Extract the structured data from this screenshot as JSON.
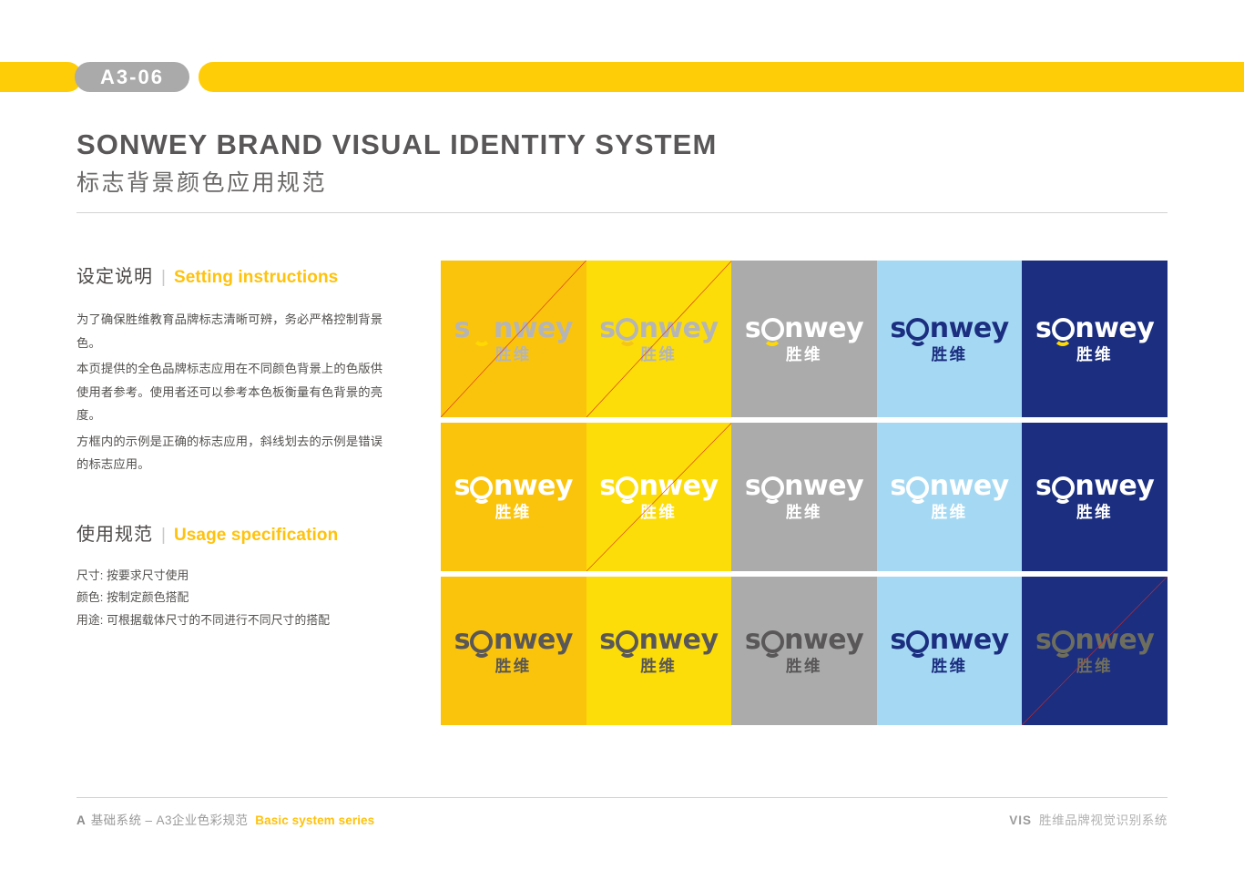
{
  "header": {
    "page_code": "A3-06",
    "bar_color": "#FFCD07",
    "pill_color": "#AAAAAA"
  },
  "title": {
    "en": "SONWEY BRAND VISUAL IDENTITY SYSTEM",
    "cn": "标志背景颜色应用规范"
  },
  "sections": [
    {
      "heading_cn": "设定说明",
      "heading_en": "Setting instructions",
      "separator": "|",
      "paragraphs": [
        "为了确保胜维教育品牌标志清晰可辨，务必严格控制背景色。",
        "本页提供的全色品牌标志应用在不同颜色背景上的色版供使用者参考。使用者还可以参考本色板衡量有色背景的亮度。",
        "方框内的示例是正确的标志应用，斜线划去的示例是错误的标志应用。"
      ]
    },
    {
      "heading_cn": "使用规范",
      "heading_en": "Usage specification",
      "separator": "|",
      "lines": [
        "尺寸: 按要求尺寸使用",
        "颜色: 按制定颜色搭配",
        "用途: 可根据载体尺寸的不同进行不同尺寸的搭配"
      ]
    }
  ],
  "logo": {
    "wordmark_before": "s",
    "wordmark_after": "nwey",
    "cn_name": "胜维",
    "o_icon": "smiley-o-icon"
  },
  "palette": {
    "golden_yellow": "#FBC40C",
    "bright_yellow": "#FCDD09",
    "gray": "#ABABAB",
    "light_blue": "#A5D9F3",
    "navy": "#1B2E80",
    "logo_white": "#FFFFFF",
    "logo_gray": "#B5B5B6",
    "logo_dark_gray": "#595757",
    "logo_navy": "#1B2E80",
    "smile_yellow": "#FFD900",
    "cross_red": "#D52B1E"
  },
  "grid": {
    "rows": [
      {
        "cells": [
          {
            "bg": "#FBC40C",
            "text_color": "#B5B5B6",
            "smile_color": "#FFD900",
            "ring_visible": false,
            "crossed": true
          },
          {
            "bg": "#FCDD09",
            "text_color": "#B5B5B6",
            "smile_color": "#F5C518",
            "ring_visible": true,
            "crossed": true
          },
          {
            "bg": "#ABABAB",
            "text_color": "#FFFFFF",
            "smile_color": "#FFD900",
            "ring_visible": true,
            "crossed": false
          },
          {
            "bg": "#A5D9F3",
            "text_color": "#1B2E80",
            "smile_color": "#1B2E80",
            "ring_visible": true,
            "crossed": false
          },
          {
            "bg": "#1B2E80",
            "text_color": "#FFFFFF",
            "smile_color": "#FFD900",
            "ring_visible": true,
            "crossed": false
          }
        ]
      },
      {
        "cells": [
          {
            "bg": "#FBC40C",
            "text_color": "#FFFFFF",
            "smile_color": "#FFFFFF",
            "ring_visible": true,
            "crossed": false
          },
          {
            "bg": "#FCDD09",
            "text_color": "#FFFFFF",
            "smile_color": "#FFFFFF",
            "ring_visible": true,
            "crossed": true
          },
          {
            "bg": "#ABABAB",
            "text_color": "#FFFFFF",
            "smile_color": "#FFFFFF",
            "ring_visible": true,
            "crossed": false
          },
          {
            "bg": "#A5D9F3",
            "text_color": "#FFFFFF",
            "smile_color": "#FFFFFF",
            "ring_visible": true,
            "crossed": false
          },
          {
            "bg": "#1B2E80",
            "text_color": "#FFFFFF",
            "smile_color": "#FFFFFF",
            "ring_visible": true,
            "crossed": false
          }
        ]
      },
      {
        "cells": [
          {
            "bg": "#FBC40C",
            "text_color": "#595757",
            "smile_color": "#595757",
            "ring_visible": true,
            "crossed": false
          },
          {
            "bg": "#FCDD09",
            "text_color": "#595757",
            "smile_color": "#595757",
            "ring_visible": true,
            "crossed": false
          },
          {
            "bg": "#ABABAB",
            "text_color": "#595757",
            "smile_color": "#595757",
            "ring_visible": true,
            "crossed": false
          },
          {
            "bg": "#A5D9F3",
            "text_color": "#1B2E80",
            "smile_color": "#1B2E80",
            "ring_visible": true,
            "crossed": false
          },
          {
            "bg": "#1B2E80",
            "text_color": "#6E6E5E",
            "smile_color": "#6E6E5E",
            "ring_visible": true,
            "crossed": true
          }
        ]
      }
    ]
  },
  "footer": {
    "left_a": "A",
    "left_cn": "基础系统 – A3企业色彩规范",
    "left_en": "Basic system series",
    "right_vis": "VIS",
    "right_cn": "胜维品牌视觉识别系统"
  }
}
